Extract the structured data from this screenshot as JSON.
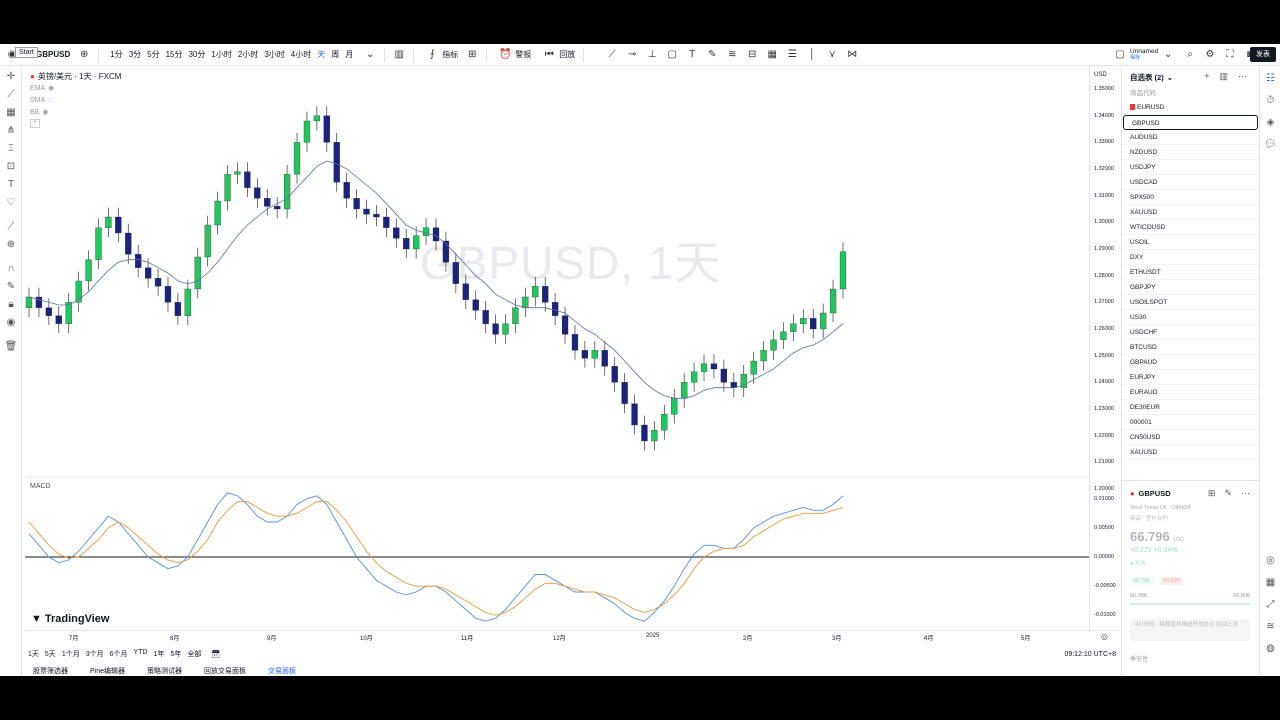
{
  "topbar": {
    "start_tooltip": "Start",
    "symbol": "GBPUSD",
    "intervals": [
      "1分",
      "3分",
      "5分",
      "15分",
      "30分",
      "1小时",
      "2小时",
      "3小时",
      "4小时",
      "天",
      "周",
      "月"
    ],
    "active_interval": "天",
    "indicators_label": "指标",
    "alert_label": "警报",
    "replay_label": "回放",
    "layout_name": "Unnamed",
    "layout_status": "保存",
    "publish_label": "发表"
  },
  "legend": {
    "title": "英镑/美元 · 1天 · FXCM",
    "ema": "EMA",
    "sma": "SMA",
    "bb": "BB"
  },
  "watermark": "GBPUSD, 1天",
  "macd_label": "MACD",
  "brand": "TradingView",
  "price_axis": {
    "currency": "USD",
    "ticks": [
      "1.35000",
      "1.34000",
      "1.33000",
      "1.32000",
      "1.31000",
      "1.30000",
      "1.29000",
      "1.28000",
      "1.27000",
      "1.26000",
      "1.25000",
      "1.24000",
      "1.23000",
      "1.22000",
      "1.21000",
      "1.20000"
    ],
    "macd_ticks": [
      "0.01000",
      "0.00500",
      "0.00000",
      "-0.00500",
      "-0.01000"
    ]
  },
  "time_axis": [
    "7月",
    "8月",
    "9月",
    "10月",
    "11月",
    "12月",
    "2025",
    "2月",
    "3月",
    "4月",
    "5月"
  ],
  "range_bar": {
    "ranges": [
      "1天",
      "5天",
      "1个月",
      "3个月",
      "6个月",
      "YTD",
      "1年",
      "5年",
      "全部"
    ],
    "clock": "09:12:10 UTC+8"
  },
  "bottom_tabs": [
    "股票筛选器",
    "Pine编辑器",
    "策略测试器",
    "回放交易面板",
    "交易面板"
  ],
  "watchlist": {
    "title": "自选表 (2)",
    "column_header": "商品代码",
    "items": [
      "EURUSD",
      "GBPUSD",
      "AUDUSD",
      "NZDUSD",
      "USDJPY",
      "USDCAD",
      "SPX500",
      "XAUUSD",
      "WTICOUSD",
      "USOIL",
      "DXY",
      "ETHUSDT",
      "GBPJPY",
      "USOILSPOT",
      "US30",
      "USDCHF",
      "BTCUSD",
      "GBPAUD",
      "EURJPY",
      "EURAUD",
      "DE30EUR",
      "000001",
      "CN50USD",
      "XAUUSD"
    ],
    "selected": "GBPUSD"
  },
  "detail": {
    "symbol": "GBPUSD",
    "subtitle": "West Texas Oil · OANDA",
    "subtitle2": "商品 · 差价合约",
    "price": "66.796",
    "unit": "USD",
    "change": "+0.229 +0.34%",
    "status": "● 开市",
    "bid": "66.796",
    "ask": "66.826",
    "range_low": "66.386",
    "range_high": "66.806",
    "note": "4小时前 · 特朗普将推进停战协议 原油上涨",
    "season": "季节性"
  },
  "chart_data": {
    "type": "candlestick",
    "symbol": "GBPUSD",
    "interval": "1D",
    "ylim": [
      1.2,
      1.35
    ],
    "x_labels": [
      "7月",
      "8月",
      "9月",
      "10月",
      "11月",
      "12月",
      "2025",
      "2月",
      "3月",
      "4月",
      "5月"
    ],
    "closes": [
      1.272,
      1.268,
      1.265,
      1.262,
      1.27,
      1.278,
      1.286,
      1.298,
      1.302,
      1.296,
      1.288,
      1.283,
      1.279,
      1.276,
      1.27,
      1.265,
      1.275,
      1.287,
      1.299,
      1.308,
      1.318,
      1.319,
      1.313,
      1.309,
      1.306,
      1.305,
      1.318,
      1.33,
      1.338,
      1.34,
      1.33,
      1.315,
      1.309,
      1.305,
      1.303,
      1.302,
      1.298,
      1.294,
      1.29,
      1.295,
      1.298,
      1.293,
      1.285,
      1.277,
      1.271,
      1.267,
      1.262,
      1.258,
      1.262,
      1.268,
      1.272,
      1.276,
      1.27,
      1.265,
      1.258,
      1.252,
      1.249,
      1.252,
      1.246,
      1.24,
      1.232,
      1.224,
      1.218,
      1.222,
      1.228,
      1.234,
      1.24,
      1.244,
      1.247,
      1.245,
      1.24,
      1.238,
      1.243,
      1.248,
      1.252,
      1.256,
      1.259,
      1.262,
      1.264,
      1.26,
      1.266,
      1.275,
      1.289
    ],
    "ma": [
      1.272,
      1.271,
      1.27,
      1.269,
      1.269,
      1.271,
      1.274,
      1.278,
      1.282,
      1.285,
      1.286,
      1.286,
      1.285,
      1.283,
      1.281,
      1.278,
      1.277,
      1.278,
      1.281,
      1.285,
      1.29,
      1.295,
      1.299,
      1.302,
      1.305,
      1.307,
      1.309,
      1.313,
      1.317,
      1.321,
      1.323,
      1.322,
      1.32,
      1.317,
      1.314,
      1.311,
      1.307,
      1.303,
      1.299,
      1.297,
      1.296,
      1.295,
      1.292,
      1.288,
      1.284,
      1.28,
      1.277,
      1.273,
      1.271,
      1.269,
      1.268,
      1.268,
      1.268,
      1.267,
      1.266,
      1.263,
      1.26,
      1.258,
      1.255,
      1.252,
      1.248,
      1.244,
      1.24,
      1.237,
      1.235,
      1.234,
      1.234,
      1.235,
      1.237,
      1.238,
      1.238,
      1.238,
      1.239,
      1.241,
      1.243,
      1.245,
      1.248,
      1.251,
      1.253,
      1.254,
      1.256,
      1.259,
      1.262
    ],
    "macd": {
      "ylim": [
        -0.012,
        0.012
      ],
      "macd_line": [
        0.004,
        0.002,
        0.0,
        -0.001,
        -0.0005,
        0.001,
        0.003,
        0.005,
        0.007,
        0.006,
        0.004,
        0.002,
        0.0,
        -0.001,
        -0.002,
        -0.0015,
        0.0,
        0.003,
        0.006,
        0.009,
        0.011,
        0.0105,
        0.009,
        0.007,
        0.006,
        0.006,
        0.007,
        0.009,
        0.01,
        0.0105,
        0.009,
        0.006,
        0.003,
        0.0,
        -0.002,
        -0.004,
        -0.005,
        -0.006,
        -0.0065,
        -0.006,
        -0.005,
        -0.005,
        -0.006,
        -0.0075,
        -0.009,
        -0.0105,
        -0.011,
        -0.0105,
        -0.009,
        -0.007,
        -0.005,
        -0.003,
        -0.003,
        -0.004,
        -0.005,
        -0.006,
        -0.006,
        -0.006,
        -0.007,
        -0.008,
        -0.0095,
        -0.0105,
        -0.011,
        -0.0095,
        -0.0075,
        -0.005,
        -0.002,
        0.0005,
        0.002,
        0.002,
        0.0015,
        0.0015,
        0.003,
        0.005,
        0.006,
        0.007,
        0.0075,
        0.008,
        0.0085,
        0.008,
        0.008,
        0.009,
        0.0105
      ],
      "signal_line": [
        0.006,
        0.004,
        0.002,
        0.0005,
        -0.0002,
        0.0,
        0.0015,
        0.003,
        0.005,
        0.006,
        0.005,
        0.0035,
        0.002,
        0.0005,
        -0.0005,
        -0.001,
        -0.0005,
        0.001,
        0.003,
        0.006,
        0.008,
        0.0095,
        0.0095,
        0.0085,
        0.0075,
        0.007,
        0.007,
        0.0075,
        0.0085,
        0.0095,
        0.0095,
        0.008,
        0.006,
        0.0035,
        0.001,
        -0.001,
        -0.0025,
        -0.0035,
        -0.0045,
        -0.005,
        -0.005,
        -0.005,
        -0.0055,
        -0.0065,
        -0.0075,
        -0.0085,
        -0.0095,
        -0.01,
        -0.0095,
        -0.0085,
        -0.007,
        -0.0055,
        -0.0045,
        -0.0045,
        -0.005,
        -0.0055,
        -0.006,
        -0.006,
        -0.0065,
        -0.007,
        -0.008,
        -0.009,
        -0.0095,
        -0.009,
        -0.008,
        -0.0065,
        -0.0045,
        -0.002,
        0.0,
        0.001,
        0.0015,
        0.0015,
        0.002,
        0.0035,
        0.0045,
        0.0055,
        0.0065,
        0.007,
        0.0075,
        0.0075,
        0.0075,
        0.008,
        0.0085
      ]
    }
  },
  "colors": {
    "up": "#22c55e",
    "down": "#1a237e",
    "ma": "#5b6b9b",
    "macd": "#5b8fd9",
    "signal": "#e09a4a"
  }
}
